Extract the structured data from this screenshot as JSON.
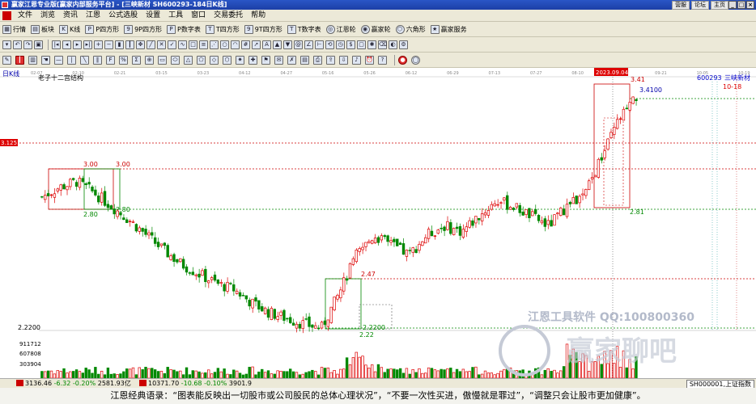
{
  "window": {
    "title": "赢家江恩专业版[赢家内部服务平台] - [三峡新材  SH600293-184日K线]",
    "links": [
      "营服",
      "论坛",
      "主页"
    ],
    "buttons": [
      "_",
      "□",
      "×"
    ]
  },
  "menu": [
    "文件",
    "浏览",
    "资讯",
    "江恩",
    "公式选股",
    "设置",
    "工具",
    "窗口",
    "交易委托",
    "帮助"
  ],
  "toolbar1": [
    {
      "icon": "grid-icon",
      "label": "行情"
    },
    {
      "icon": "blocks-icon",
      "label": "板块"
    },
    {
      "icon": "k-icon",
      "label": "K线"
    },
    {
      "icon": "p-square-icon",
      "label": "P四方形"
    },
    {
      "icon": "9p-square-icon",
      "label": "9P四方形"
    },
    {
      "icon": "p-table-icon",
      "label": "P数字表"
    },
    {
      "icon": "t-square-icon",
      "label": "T四方形"
    },
    {
      "icon": "9t-square-icon",
      "label": "9T四方形"
    },
    {
      "icon": "t-table-icon",
      "label": "T数字表"
    },
    {
      "icon": "gann-wheel-icon",
      "label": "江恩轮"
    },
    {
      "icon": "winner-wheel-icon",
      "label": "赢家轮"
    },
    {
      "icon": "hexagon-icon",
      "label": "六角形"
    },
    {
      "icon": "winner-service-icon",
      "label": "赢家服务"
    }
  ],
  "chart": {
    "period_label": "日K线",
    "indicator_label": "老子十二宫结构",
    "stock_code": "600293",
    "stock_name": "三峡新材",
    "date_info": "10-18",
    "highlight_date": "2023.09.04",
    "price_label_left": "3.1251",
    "low_label_left": "2.2200",
    "axis_dates": [
      "02-07",
      "02-10",
      "02-21",
      "03-15",
      "03-23",
      "04-12",
      "04-27",
      "05-16",
      "05-26",
      "06-12",
      "06-29",
      "07-13",
      "07-27",
      "08-10",
      "08-24",
      "09-21",
      "10-05",
      "10-19"
    ],
    "annotations": {
      "a300": "3.00",
      "b300": "3.00",
      "a280": "2.80",
      "b280": "2.80",
      "a247": "2.47",
      "a22200": "2.2200",
      "a222": "2.22",
      "a341": "3.41",
      "a34100": "3.4100",
      "a281": "2.81"
    },
    "volume_labels": [
      "911712",
      "607808",
      "303904"
    ],
    "watermark1": "江恩工具软件 QQ:100800360",
    "watermark2": "赢家聊吧"
  },
  "chart_data": {
    "type": "candlestick",
    "ylabel": "",
    "ylim": [
      2.1,
      3.5
    ],
    "x": [
      "2023-02",
      "2023-03",
      "2023-04",
      "2023-05",
      "2023-06",
      "2023-07",
      "2023-08",
      "2023-09",
      "2023-10"
    ],
    "close_path": [
      2.9,
      2.95,
      2.98,
      2.92,
      2.85,
      2.78,
      2.7,
      2.62,
      2.55,
      2.5,
      2.45,
      2.42,
      2.35,
      2.3,
      2.27,
      2.24,
      2.22,
      2.4,
      2.6,
      2.7,
      2.65,
      2.6,
      2.7,
      2.75,
      2.72,
      2.8,
      2.88,
      2.85,
      2.8,
      2.75,
      2.85,
      2.9,
      3.1,
      3.3,
      3.41
    ],
    "levels": [
      3.0,
      2.8,
      2.47,
      2.22,
      3.41,
      2.81,
      3.1251
    ]
  },
  "status": {
    "index1": "3136.46",
    "chg1": "-6.32",
    "pct1": "-0.20%",
    "amt1": "2581.93亿",
    "index2": "10371.70",
    "chg2": "-10.68",
    "pct2": "-0.10%",
    "amt2": "3901.9",
    "tab": "SH000001,上证指数"
  },
  "caption": "江恩经典语录：“图表能反映出一切股市或公司股民的总体心理状况”，“不要一次性买进，傲慢就是罪过”，“调整只会让股市更加健康”。"
}
